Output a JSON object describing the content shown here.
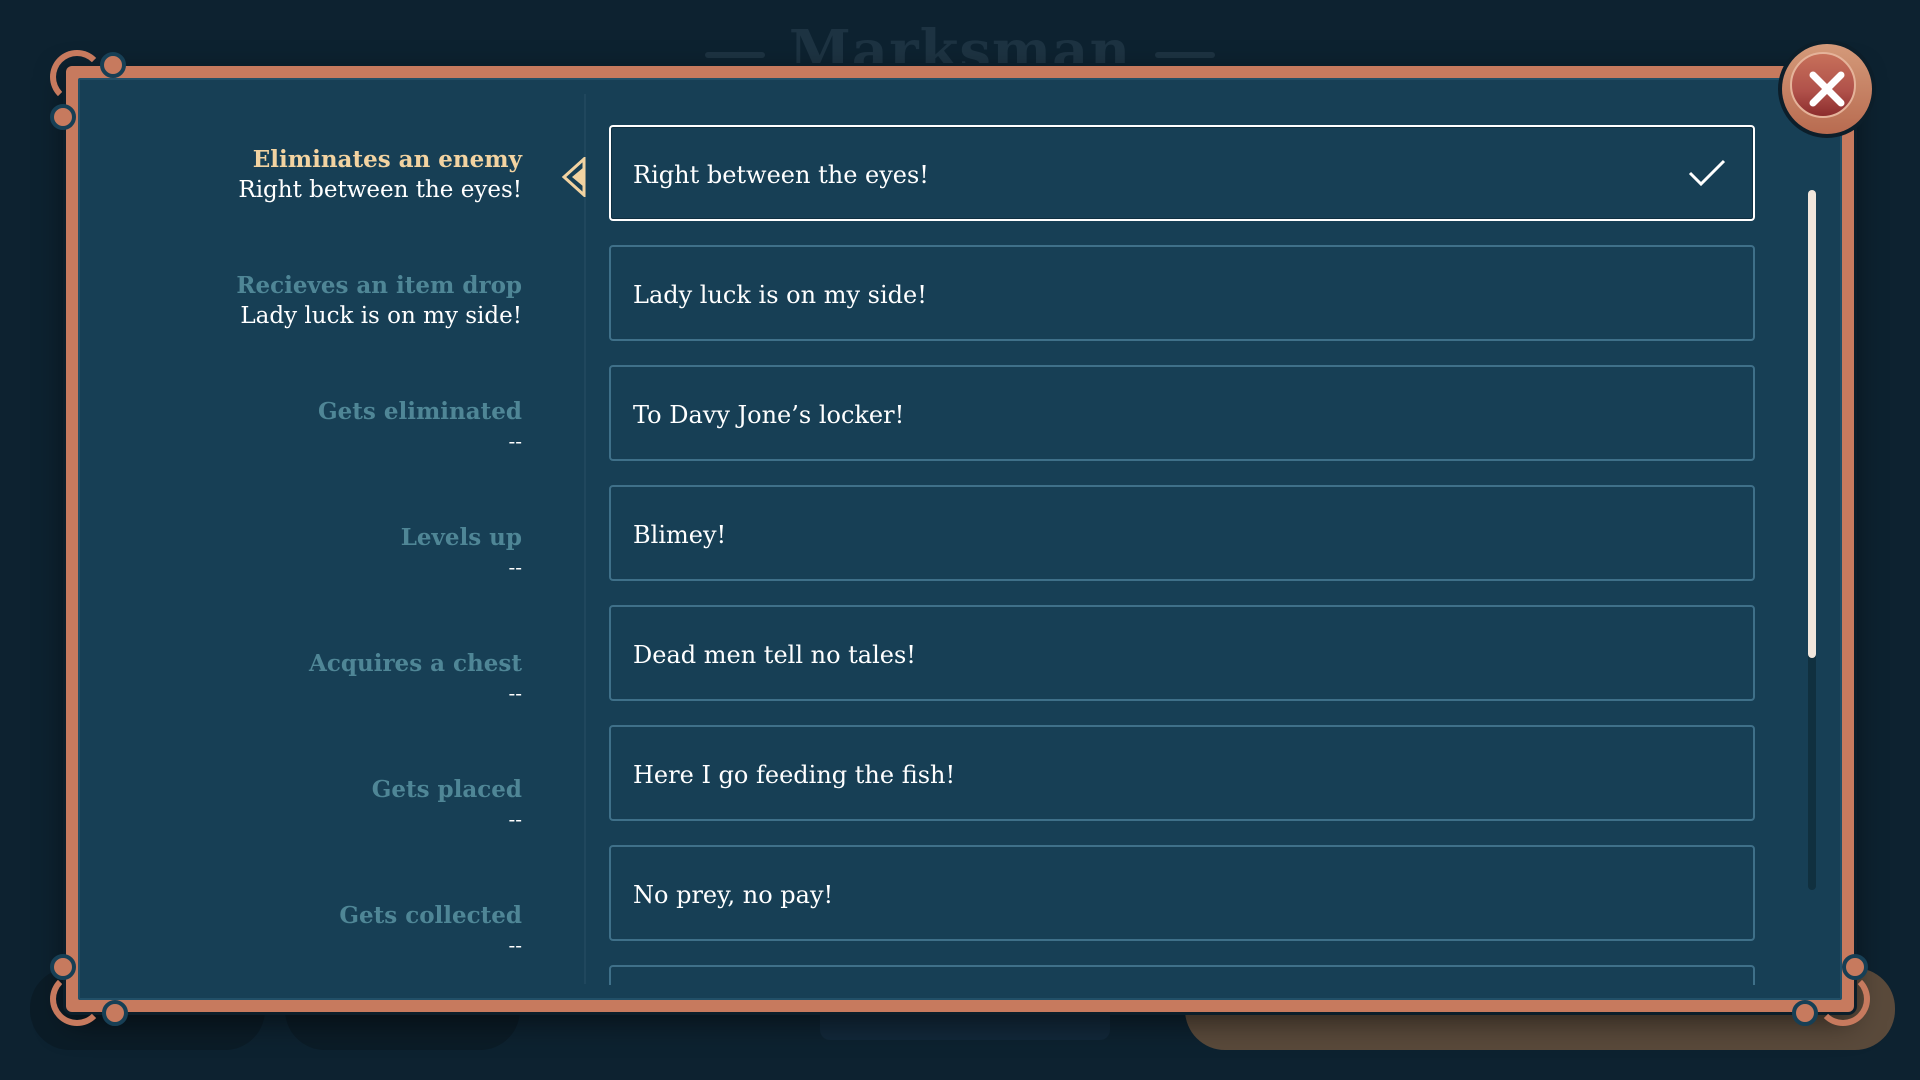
{
  "background": {
    "title": "Marksman"
  },
  "triggers": [
    {
      "name": "Eliminates an enemy",
      "value": "Right between the eyes!",
      "active": true
    },
    {
      "name": "Recieves an item drop",
      "value": "Lady luck is on my side!",
      "active": false
    },
    {
      "name": "Gets eliminated",
      "value": "--",
      "active": false
    },
    {
      "name": "Levels up",
      "value": "--",
      "active": false
    },
    {
      "name": "Acquires a chest",
      "value": "--",
      "active": false
    },
    {
      "name": "Gets placed",
      "value": "--",
      "active": false
    },
    {
      "name": "Gets collected",
      "value": "--",
      "active": false
    }
  ],
  "options": [
    {
      "text": "Right between the eyes!",
      "selected": true
    },
    {
      "text": "Lady luck is on my side!",
      "selected": false
    },
    {
      "text": "To Davy Jone’s locker!",
      "selected": false
    },
    {
      "text": "Blimey!",
      "selected": false
    },
    {
      "text": "Dead men tell no tales!",
      "selected": false
    },
    {
      "text": "Here I go feeding the fish!",
      "selected": false
    },
    {
      "text": "No prey, no pay!",
      "selected": false
    },
    {
      "text": "",
      "selected": false
    }
  ],
  "icons": {
    "close": "close-x-icon",
    "check": "checkmark-icon",
    "selector": "chevron-left-icon"
  },
  "colors": {
    "frame": "#c77a5e",
    "panel": "#173f55",
    "active_label": "#f2d3a1",
    "inactive_label": "#4f8696"
  }
}
